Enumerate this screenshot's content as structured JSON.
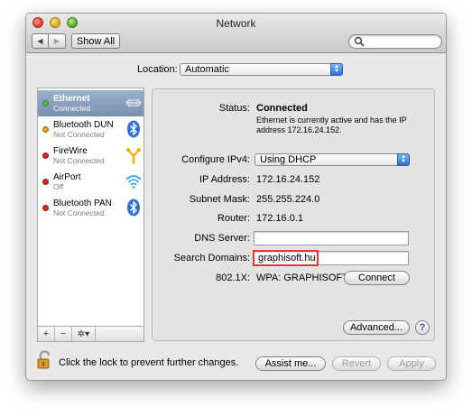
{
  "window": {
    "title": "Network"
  },
  "toolbar": {
    "back_glyph": "◀",
    "forward_glyph": "▶",
    "show_all_label": "Show All",
    "search_value": ""
  },
  "location": {
    "label": "Location:",
    "value": "Automatic"
  },
  "services": [
    {
      "name": "Ethernet",
      "status": "Connected",
      "dot_color": "#4cbd3a",
      "icon": "ethernet-icon",
      "selected": true
    },
    {
      "name": "Bluetooth DUN",
      "status": "Not Connected",
      "dot_color": "#e8a317",
      "icon": "bluetooth-icon"
    },
    {
      "name": "FireWire",
      "status": "Not Connected",
      "dot_color": "#d8241b",
      "icon": "firewire-icon"
    },
    {
      "name": "AirPort",
      "status": "Off",
      "dot_color": "#d8241b",
      "icon": "wifi-icon"
    },
    {
      "name": "Bluetooth PAN",
      "status": "Not Connected",
      "dot_color": "#d8241b",
      "icon": "bluetooth-icon"
    }
  ],
  "sidebar_tools": {
    "add": "+",
    "remove": "−",
    "gear": "✲▾"
  },
  "details": {
    "status_label": "Status:",
    "status_value": "Connected",
    "status_desc_line1": "Ethernet is currently active and has the IP",
    "status_desc_line2": "address 172.16.24.152.",
    "configure_label": "Configure IPv4:",
    "configure_value": "Using DHCP",
    "ip_label": "IP Address:",
    "ip_value": "172.16.24.152",
    "subnet_label": "Subnet Mask:",
    "subnet_value": "255.255.224.0",
    "router_label": "Router:",
    "router_value": "172.16.0.1",
    "dns_label": "DNS Server:",
    "dns_value": "",
    "search_domains_label": "Search Domains:",
    "search_domains_value": "graphisoft.hu",
    "x8021_label": "802.1X:",
    "x8021_value": "WPA: GRAPHISOFT",
    "connect_label": "Connect",
    "advanced_label": "Advanced...",
    "help_label": "?"
  },
  "footer": {
    "lock_text": "Click the lock to prevent further changes.",
    "assist_label": "Assist me...",
    "revert_label": "Revert",
    "apply_label": "Apply"
  },
  "colors": {
    "highlight": "#e03a32",
    "selection": "#7890b1"
  }
}
